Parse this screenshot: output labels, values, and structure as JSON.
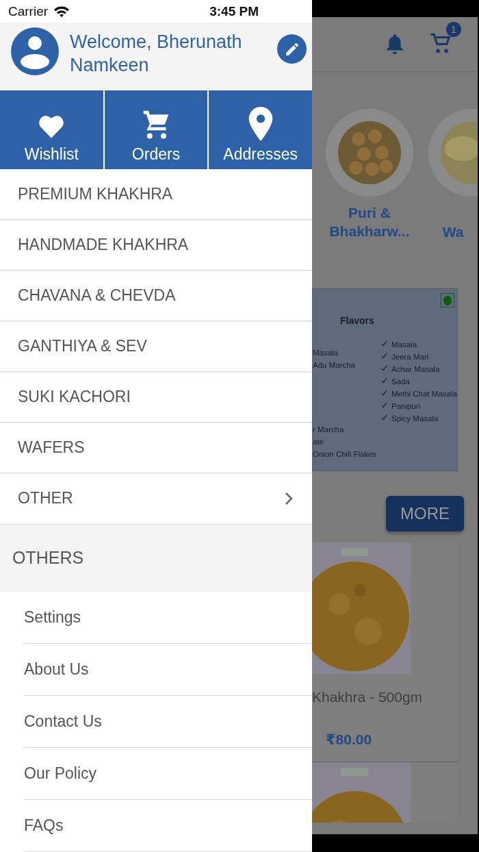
{
  "status_bar": {
    "carrier": "Carrier",
    "time": "3:45 PM"
  },
  "drawer": {
    "profile": {
      "greeting": "Welcome, Bherunath Namkeen"
    },
    "quick_links": [
      {
        "kind": "heart",
        "label": "Wishlist"
      },
      {
        "kind": "cart",
        "label": "Orders"
      },
      {
        "kind": "pin",
        "label": "Addresses"
      }
    ],
    "categories": [
      {
        "label": "PREMIUM KHAKHRA",
        "expandable": false
      },
      {
        "label": "HANDMADE KHAKHRA",
        "expandable": false
      },
      {
        "label": "CHAVANA & CHEVDA",
        "expandable": false
      },
      {
        "label": "GANTHIYA & SEV",
        "expandable": false
      },
      {
        "label": "SUKI KACHORI",
        "expandable": false
      },
      {
        "label": "WAFERS",
        "expandable": false
      },
      {
        "label": "OTHER",
        "expandable": true
      }
    ],
    "section": {
      "title": "OTHERS",
      "links": [
        "Settings",
        "About Us",
        "Contact Us",
        "Our Policy",
        "FAQs"
      ]
    }
  },
  "background_page": {
    "cart_badge": "1",
    "categories": [
      {
        "label": "Puri & Bhakharw..."
      },
      {
        "label": "Wa"
      }
    ],
    "flavors_banner": {
      "title": "Flavors",
      "left_groups": [
        [
          "Masala",
          "Adu Marcha"
        ],
        [
          "r Marcha",
          "ate",
          "Onion Chili Flakes"
        ]
      ],
      "right_items": [
        "Masala",
        "Jeera Mari",
        "Achar Masala",
        "Sada",
        "Methi Chat Masala",
        "Panipuri",
        "Spicy Masala"
      ]
    },
    "more_button": "MORE",
    "product": {
      "name": "Khakhra - 500gm",
      "price": "₹80.00"
    }
  }
}
